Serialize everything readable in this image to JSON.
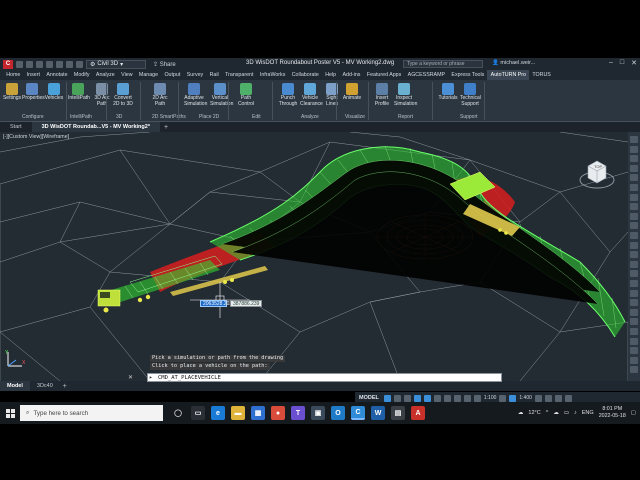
{
  "titlebar": {
    "app_logo": "C",
    "workspace": "Civil 3D",
    "share_label": "Share",
    "title": "3D WisDOT Roundabout Poster V5 - MV Working2.dwg",
    "search_placeholder": "Type a keyword or phrase",
    "user": "michael.weir...",
    "window_controls": [
      "–",
      "□",
      "✕"
    ]
  },
  "ribbon_tabs": [
    "Home",
    "Insert",
    "Annotate",
    "Modify",
    "Analyze",
    "View",
    "Manage",
    "Output",
    "Survey",
    "Rail",
    "Transparent",
    "InfraWorks",
    "Collaborate",
    "Help",
    "Add-ins",
    "Featured Apps",
    "AGCESSRAMP",
    "Express Tools",
    "AutoTURN Pro",
    "TORUS"
  ],
  "active_ribbon_tab": "AutoTURN Pro",
  "ribbon": {
    "tools": [
      {
        "label": "Settings",
        "color": "#c9a23a"
      },
      {
        "label": "Properties",
        "color": "#5a86c4"
      },
      {
        "label": "Vehicles",
        "color": "#4aa0d8"
      },
      {
        "label": "IntelliPath",
        "color": "#49a35a"
      },
      {
        "label": "3D Arc Path",
        "color": "#7a8fa6"
      },
      {
        "label": "Convert 2D to 3D",
        "color": "#5a9fd3"
      },
      {
        "label": "2D Arc Path",
        "color": "#6d8ab0"
      },
      {
        "label": "Adaptive Simulation",
        "color": "#4f7fbf"
      },
      {
        "label": "Vertical Simulation",
        "color": "#5b8fc9"
      },
      {
        "label": "Path Control",
        "color": "#4fb06a"
      },
      {
        "label": "Punch Through",
        "color": "#4a8ad0"
      },
      {
        "label": "Vehicle Clearance",
        "color": "#5fa7d8"
      },
      {
        "label": "Sight Lines",
        "color": "#7ca0c8"
      },
      {
        "label": "Animate",
        "color": "#d0a030"
      },
      {
        "label": "Insert Profile",
        "color": "#5c7fa8"
      },
      {
        "label": "Inspect Simulation",
        "color": "#6ab0d0"
      },
      {
        "label": "Tutorials",
        "color": "#4b8fd6"
      },
      {
        "label": "Technical Support",
        "color": "#3f7fc9"
      }
    ],
    "panels": [
      "Configure",
      "IntelliPath",
      "3D",
      "2D SmartPaths",
      "Place 2D",
      "Edit",
      "Analyze",
      "Visualize",
      "Report",
      "Support"
    ]
  },
  "doc_tabs": [
    "Start",
    "3D WisDOT Roundab...V5 - MV Working2*"
  ],
  "active_doc_tab": "3D WisDOT Roundab...V5 - MV Working2*",
  "viewport": {
    "view_label": "[-][Custom View][Wireframe]",
    "coord_x": "2063528.202",
    "coord_y": "387886.239",
    "viewcube_label": "TOP",
    "ucs_x": "X",
    "ucs_y": "Y"
  },
  "command": {
    "history": [
      "Pick a simulation or path from the drawing",
      "Click to place a vehicle on the path:"
    ],
    "current": "CMD_AT_PLACEVEHICLE"
  },
  "layout_tabs": [
    "Model",
    "3Dc40"
  ],
  "active_layout_tab": "Model",
  "status_bar": {
    "space": "MODEL",
    "scale": "1:100",
    "anno_scale": "1:400"
  },
  "taskbar": {
    "search_placeholder": "Type here to search",
    "weather": "12°C",
    "lang": "ENG",
    "time": "8:01 PM",
    "date": "2022-05-18"
  },
  "colors": {
    "truck_green": "#3ee83e",
    "envelope_red": "#e22020",
    "ribbon_bg": "#2c3640",
    "accent": "#3b8fd8"
  }
}
